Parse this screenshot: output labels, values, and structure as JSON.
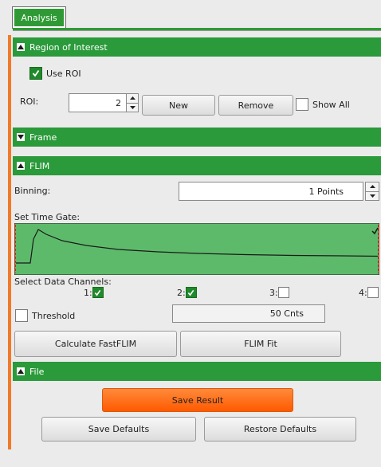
{
  "tab": {
    "label": "Analysis"
  },
  "roi": {
    "header": "Region of Interest",
    "use_roi_label": "Use ROI",
    "use_roi_checked": true,
    "roi_label": "ROI:",
    "roi_value": "2",
    "new_label": "New",
    "remove_label": "Remove",
    "show_all_label": "Show All",
    "show_all_checked": false
  },
  "frame": {
    "header": "Frame"
  },
  "flim": {
    "header": "FLIM",
    "binning_label": "Binning:",
    "binning_value": "1 Points",
    "time_gate_label": "Set Time Gate:",
    "channels_label": "Select Data Channels:",
    "channels": [
      {
        "label": "1:",
        "checked": true
      },
      {
        "label": "2:",
        "checked": true
      },
      {
        "label": "3:",
        "checked": false
      },
      {
        "label": "4:",
        "checked": false
      }
    ],
    "threshold_label": "Threshold",
    "threshold_checked": false,
    "threshold_value": "50 Cnts",
    "calc_label": "Calculate FastFLIM",
    "fit_label": "FLIM Fit"
  },
  "file": {
    "header": "File",
    "save_result_label": "Save Result",
    "save_defaults_label": "Save Defaults",
    "restore_defaults_label": "Restore Defaults"
  },
  "colors": {
    "accent_green": "#2a9a3a",
    "orange": "#ff5a00"
  }
}
